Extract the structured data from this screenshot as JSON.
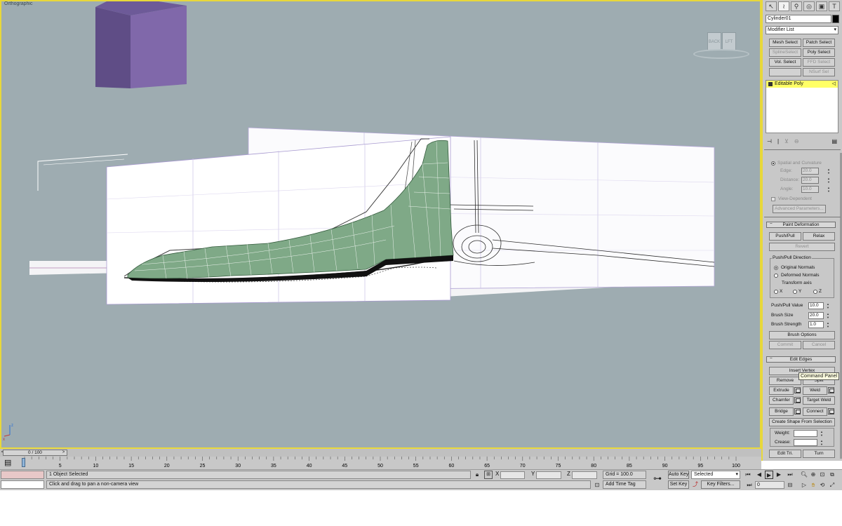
{
  "viewport": {
    "label": "Orthographic",
    "viewcube_faces": [
      "BACK",
      "LFT"
    ],
    "tooltip": "Command Panel"
  },
  "command_panel": {
    "object_name": "Cylinder01",
    "modifier_list": "Modifier List",
    "modifier_buttons": [
      "Mesh Select",
      "Patch Select",
      "SplineSelect",
      "Poly Select",
      "Vol. Select",
      "FFD Select",
      "",
      "NSurf Sel"
    ],
    "stack_item": "Editable Poly",
    "spatial_curvature": "Spatial and Curvature",
    "edge_label": "Edge:",
    "edge_value": "20.0",
    "distance_label": "Distance:",
    "distance_value": "20.0",
    "angle_label": "Angle:",
    "angle_value": "10.0",
    "view_dependent": "View-Dependent",
    "advanced_params": "Advanced Parameters...",
    "paint_deformation": "Paint Deformation",
    "push_pull": "Push/Pull",
    "relax": "Relax",
    "revert": "Revert",
    "direction_group": "Push/Pull Direction",
    "original_normals": "Original Normals",
    "deformed_normals": "Deformed Normals",
    "transform_axis": "Transform axis",
    "axis_x": "X",
    "axis_y": "Y",
    "axis_z": "Z",
    "push_pull_value_label": "Push/Pull Value",
    "push_pull_value": "10.0",
    "brush_size_label": "Brush Size",
    "brush_size": "20.0",
    "brush_strength_label": "Brush Strength",
    "brush_strength": "1.0",
    "brush_options": "Brush Options",
    "commit": "Commit",
    "cancel": "Cancel",
    "edit_edges": "Edit Edges",
    "insert_vertex": "Insert Vertex",
    "remove": "Remove",
    "split": "Split",
    "extrude": "Extrude",
    "weld": "Weld",
    "chamfer": "Chamfer",
    "target_weld": "Target Weld",
    "bridge": "Bridge",
    "connect": "Connect",
    "create_shape": "Create Shape From Selection",
    "weight_label": "Weight:",
    "crease_label": "Crease:",
    "edit_tri": "Edit Tri.",
    "turn": "Turn"
  },
  "timeline": {
    "frame_display": "0 / 100",
    "ticks": [
      "5",
      "10",
      "15",
      "20",
      "25",
      "30",
      "35",
      "40",
      "45",
      "50",
      "55",
      "60",
      "65",
      "70",
      "75",
      "80",
      "85",
      "90",
      "95",
      "100"
    ],
    "current_frame_value": 0,
    "max_frame": 100
  },
  "statusbar": {
    "selection_info": "1 Object Selected",
    "prompt": "Click and drag to pan a non-camera view",
    "x_label": "X",
    "y_label": "Y",
    "z_label": "Z",
    "grid": "Grid = 100.0",
    "add_time_tag": "Add Time Tag",
    "auto_key": "Auto Key",
    "set_key": "Set Key",
    "selected_option": "Selected",
    "key_filters": "Key Filters...",
    "frame_field": "0",
    "colors": {
      "swatch_top": "#e8c8c8",
      "viewport_bg": "#9eacb1",
      "active_border": "#e8d83a",
      "stack_highlight": "#ffff66",
      "mesh_green": "#7fa987",
      "box_purple": "#7f6aa8"
    }
  }
}
